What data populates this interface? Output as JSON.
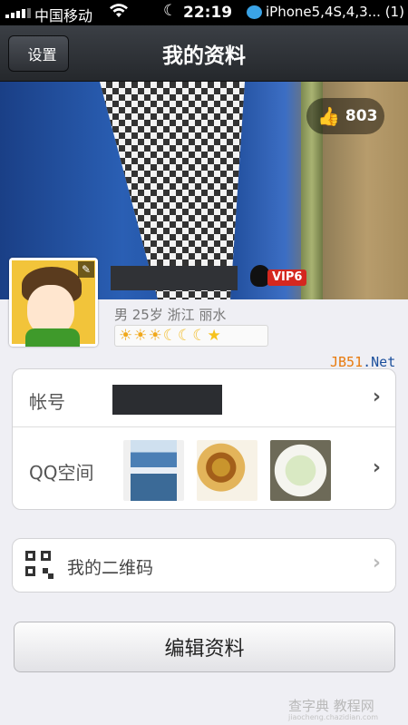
{
  "status_bar": {
    "carrier": "中国移动",
    "time": "22:19",
    "notice": "iPhone5,4S,4,3... (1)"
  },
  "nav": {
    "back_label": "设置",
    "title": "我的资料"
  },
  "cover": {
    "like_count": "803"
  },
  "profile": {
    "vip_badge": "VIP6",
    "meta_text": "男  25岁  浙江  丽水",
    "level_icons": [
      "sun",
      "sun",
      "sun",
      "moon",
      "moon",
      "moon",
      "star"
    ]
  },
  "watermark_jb51": {
    "a": "JB51",
    "b": ".Net"
  },
  "account_card": {
    "account_label": "帐号",
    "qzone_label": "QQ空间"
  },
  "qr_row": {
    "label": "我的二维码"
  },
  "edit_button": {
    "label": "编辑资料"
  },
  "watermark": {
    "main": "查字典 教程网",
    "sub": "jiaocheng.chazidian.com"
  },
  "icons": {
    "back": "back-arrow-icon",
    "like": "thumbs-up-icon",
    "chevron": "chevron-right-icon",
    "qr": "qr-code-icon"
  },
  "colors": {
    "vip_red": "#d4281f",
    "navbar_dark": "#2c2f34"
  }
}
